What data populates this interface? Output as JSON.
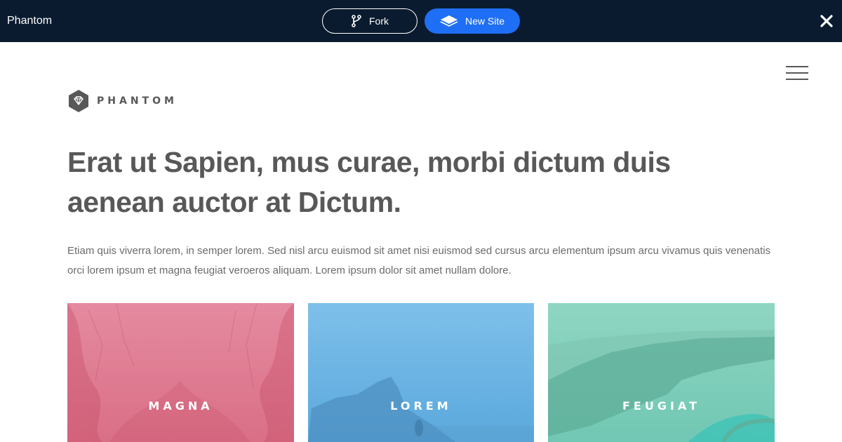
{
  "topbar": {
    "title": "Phantom",
    "fork_label": "Fork",
    "new_site_label": "New Site",
    "background_color": "#0b1b2f",
    "accent_color": "#1e6ff5"
  },
  "site": {
    "logo_text": "PHANTOM",
    "headline": "Erat ut Sapien, mus curae, morbi dictum duis aenean auctor at Dictum.",
    "intro": "Etiam quis viverra lorem, in semper lorem. Sed nisl arcu euismod sit amet nisi euismod sed cursus arcu elementum ipsum arcu vivamus quis venenatis orci lorem ipsum et magna feugiat veroeros aliquam. Lorem ipsum dolor sit amet nullam dolore.",
    "tiles": [
      {
        "label": "MAGNA",
        "color": "#e07a92"
      },
      {
        "label": "LOREM",
        "color": "#6fb4e4"
      },
      {
        "label": "FEUGIAT",
        "color": "#80cfba"
      }
    ]
  },
  "icons": {
    "fork": "git-fork-icon",
    "new_site": "stack-layers-icon",
    "close": "close-icon",
    "menu": "hamburger-menu-icon",
    "logo": "diamond-hexagon-logo-icon"
  }
}
